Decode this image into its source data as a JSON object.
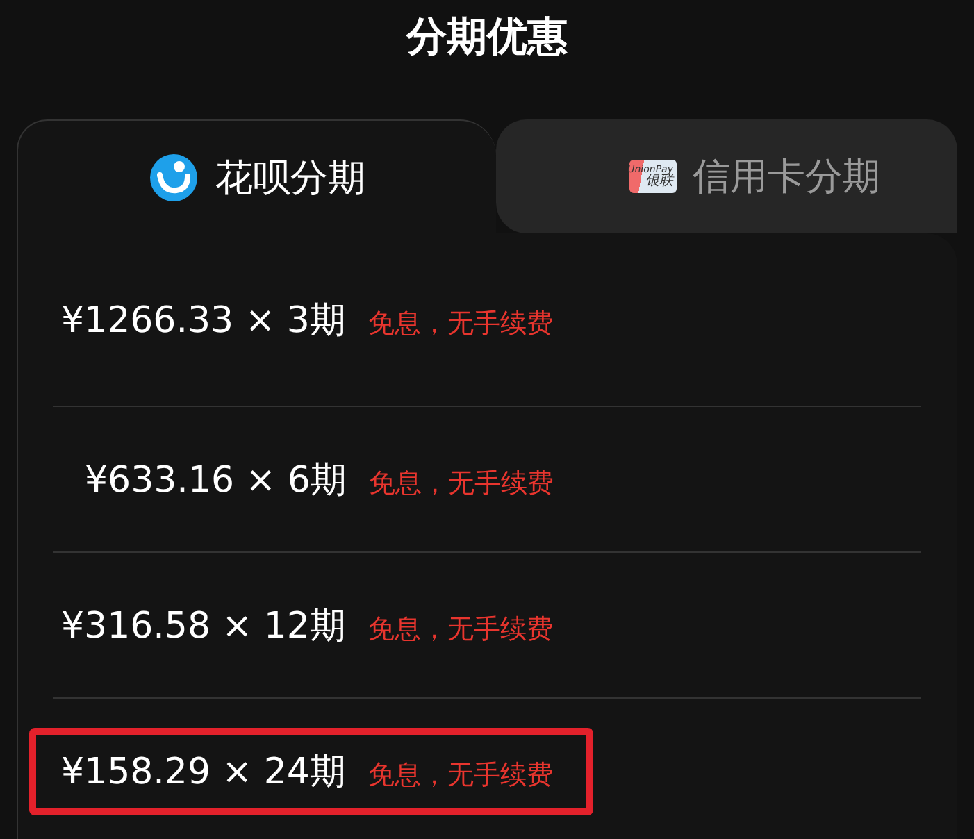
{
  "title": "分期优惠",
  "tabs": [
    {
      "kind": "huabei",
      "label": "花呗分期",
      "selected": true
    },
    {
      "kind": "card",
      "label": "信用卡分期",
      "selected": false,
      "logo_text": [
        "UnionPay",
        "银联"
      ]
    }
  ],
  "plans": [
    {
      "amount": "¥1266.33 × 3期",
      "note": "免息，无手续费",
      "highlighted": false
    },
    {
      "amount": "¥633.16 × 6期",
      "note": "免息，无手续费",
      "highlighted": false
    },
    {
      "amount": "¥316.58 × 12期",
      "note": "免息，无手续费",
      "highlighted": false
    },
    {
      "amount": "¥158.29 × 24期",
      "note": "免息，无手续费",
      "highlighted": true
    }
  ]
}
